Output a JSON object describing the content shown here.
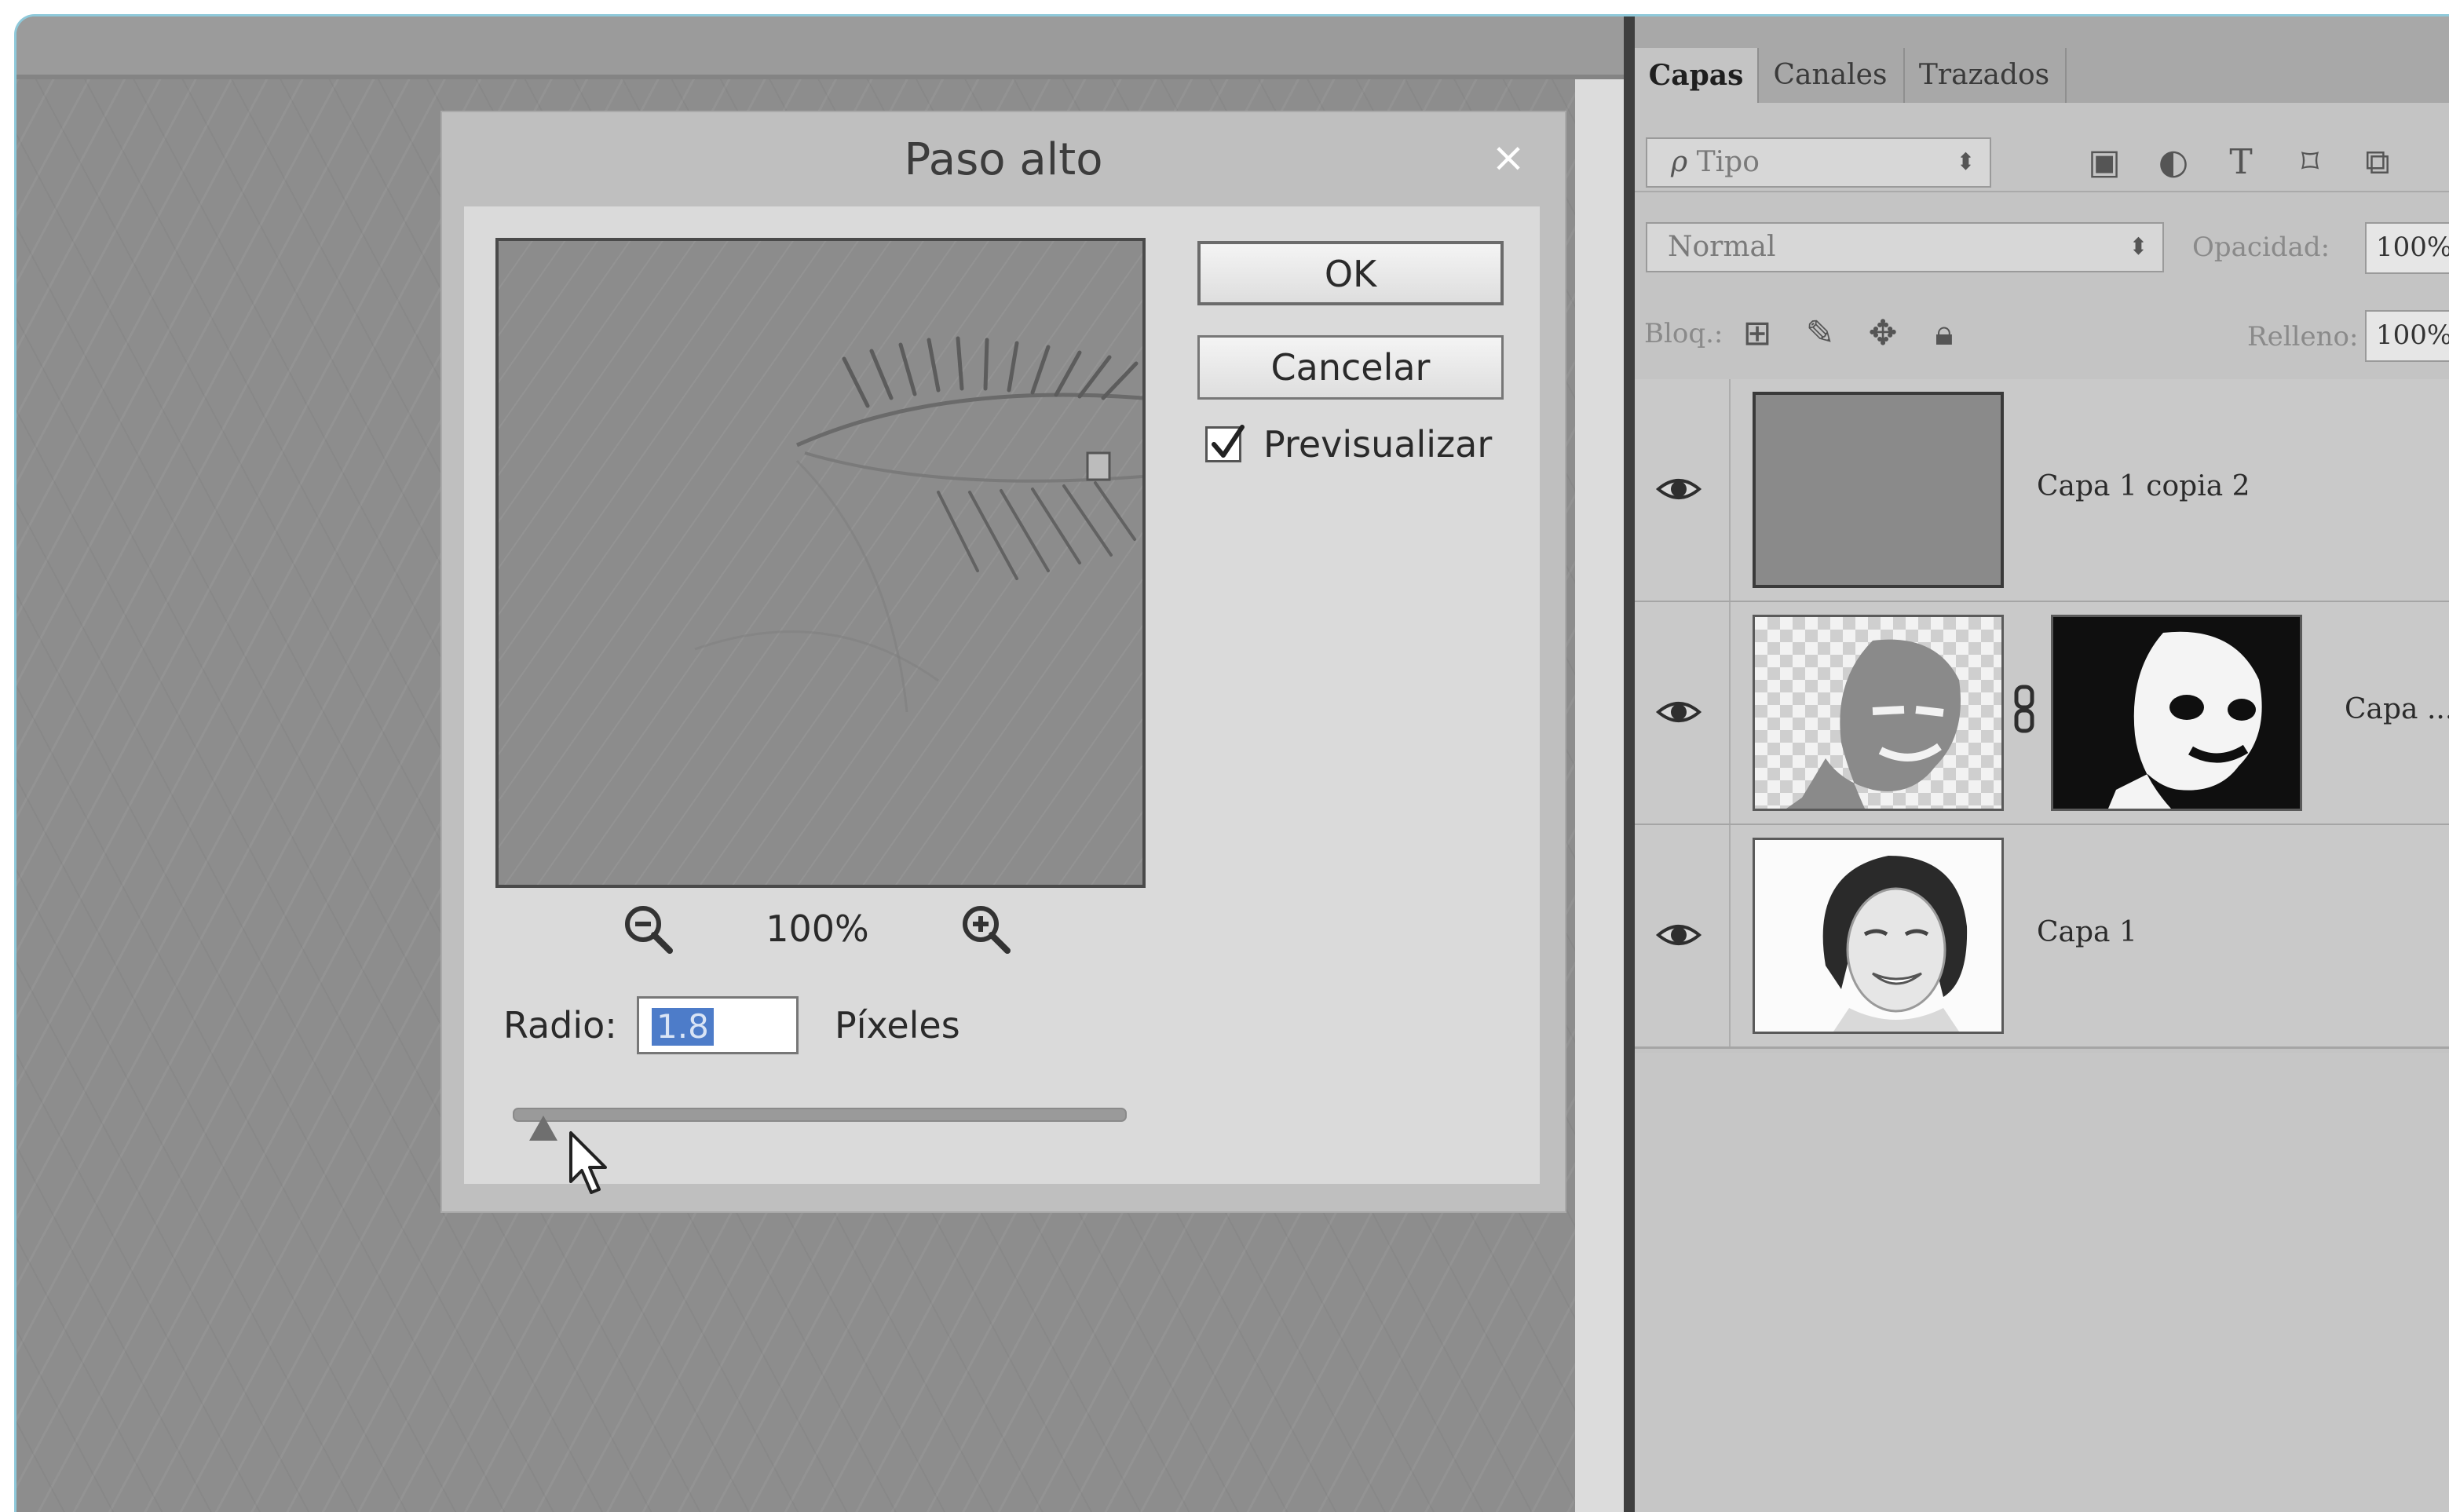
{
  "dialog": {
    "title": "Paso alto",
    "close_glyph": "×",
    "ok_label": "OK",
    "cancel_label": "Cancelar",
    "preview_label": "Previsualizar",
    "preview_checked": true,
    "zoom_value": "100%",
    "radius_label": "Radio:",
    "radius_value": "1.8",
    "radius_unit": "Píxeles",
    "slider_fraction": 0.05
  },
  "layers_panel": {
    "tabs": [
      {
        "label": "Capas",
        "active": true
      },
      {
        "label": "Canales",
        "active": false
      },
      {
        "label": "Trazados",
        "active": false
      }
    ],
    "filter": {
      "icon": "ρ",
      "value": "Tipo"
    },
    "filter_icons": [
      "image-filter-icon",
      "adjustment-filter-icon",
      "type-filter-icon",
      "shape-filter-icon",
      "smart-object-filter-icon"
    ],
    "blend_mode": "Normal",
    "opacity_label": "Opacidad:",
    "opacity_value": "100%",
    "lock_label": "Bloq.:",
    "fill_label": "Relleno:",
    "fill_value": "100%",
    "layers": [
      {
        "name": "Capa 1 copia 2",
        "visible": true,
        "thumb": "gray-fill"
      },
      {
        "name": "Capa ...",
        "visible": true,
        "thumb": "masked-face"
      },
      {
        "name": "Capa 1",
        "visible": true,
        "thumb": "portrait"
      }
    ]
  },
  "colors": {
    "canvas": "#8d8d8d",
    "panel": "#c4c4c4",
    "selection": "#4d7cc9",
    "frame_accent": "#8fc9da"
  }
}
